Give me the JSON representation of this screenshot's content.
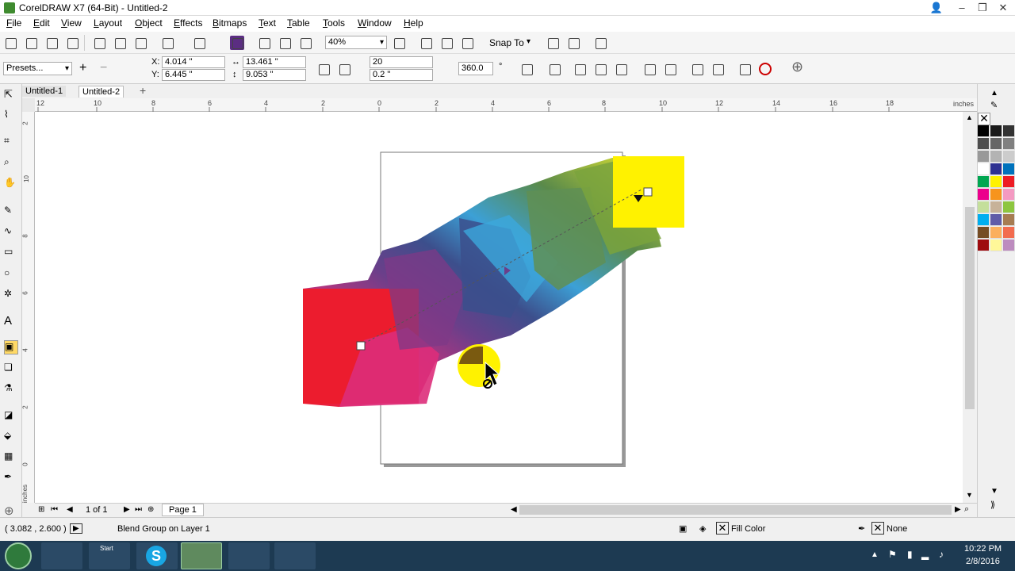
{
  "window": {
    "title": "CorelDRAW X7 (64-Bit) - Untitled-2"
  },
  "menu": [
    "File",
    "Edit",
    "View",
    "Layout",
    "Object",
    "Effects",
    "Bitmaps",
    "Text",
    "Table",
    "Tools",
    "Window",
    "Help"
  ],
  "toolbar": {
    "zoom": "40%",
    "snap_to": "Snap To"
  },
  "propbar": {
    "presets": "Presets...",
    "x": "4.014 \"",
    "y": "6.445 \"",
    "w": "13.461 \"",
    "h": "9.053 \"",
    "steps": "20",
    "spacing": "0.2 \"",
    "rotation": "360.0",
    "degree": "°"
  },
  "doc_tabs": [
    "Untitled-1",
    "Untitled-2"
  ],
  "ruler": {
    "h_ticks": [
      "12",
      "10",
      "8",
      "6",
      "4",
      "2",
      "0",
      "2",
      "4",
      "6",
      "8",
      "10",
      "12",
      "14",
      "16",
      "18"
    ],
    "h_unit": "inches",
    "v_ticks": [
      "2",
      "10",
      "8",
      "6",
      "4",
      "2",
      "0"
    ],
    "v_unit": "inches"
  },
  "page_nav": {
    "page_count": "1 of 1",
    "page_tab": "Page 1"
  },
  "status": {
    "coords": "( 3.082 , 2.600 )",
    "object": "Blend Group on Layer 1",
    "fill": "Fill Color",
    "outline": "None"
  },
  "taskbar": {
    "start_label": "Start",
    "time": "10:22 PM",
    "date": "2/8/2016"
  },
  "colors": {
    "palette": [
      "#000000",
      "#1a1a1a",
      "#333333",
      "#4d4d4d",
      "#666666",
      "#808080",
      "#999999",
      "#b3b3b3",
      "#cccccc",
      "#ffffff",
      "#2e3192",
      "#0072bc",
      "#00a651",
      "#fff200",
      "#ed1c24",
      "#ec008c",
      "#f7941d",
      "#f49ac2",
      "#c4df9b",
      "#c7b299",
      "#8dc63f",
      "#00aeef",
      "#605ca8",
      "#a67c52",
      "#754c24",
      "#fbaf5d",
      "#f26c4f",
      "#9e0b0f",
      "#fff799",
      "#bd8cbf"
    ]
  }
}
